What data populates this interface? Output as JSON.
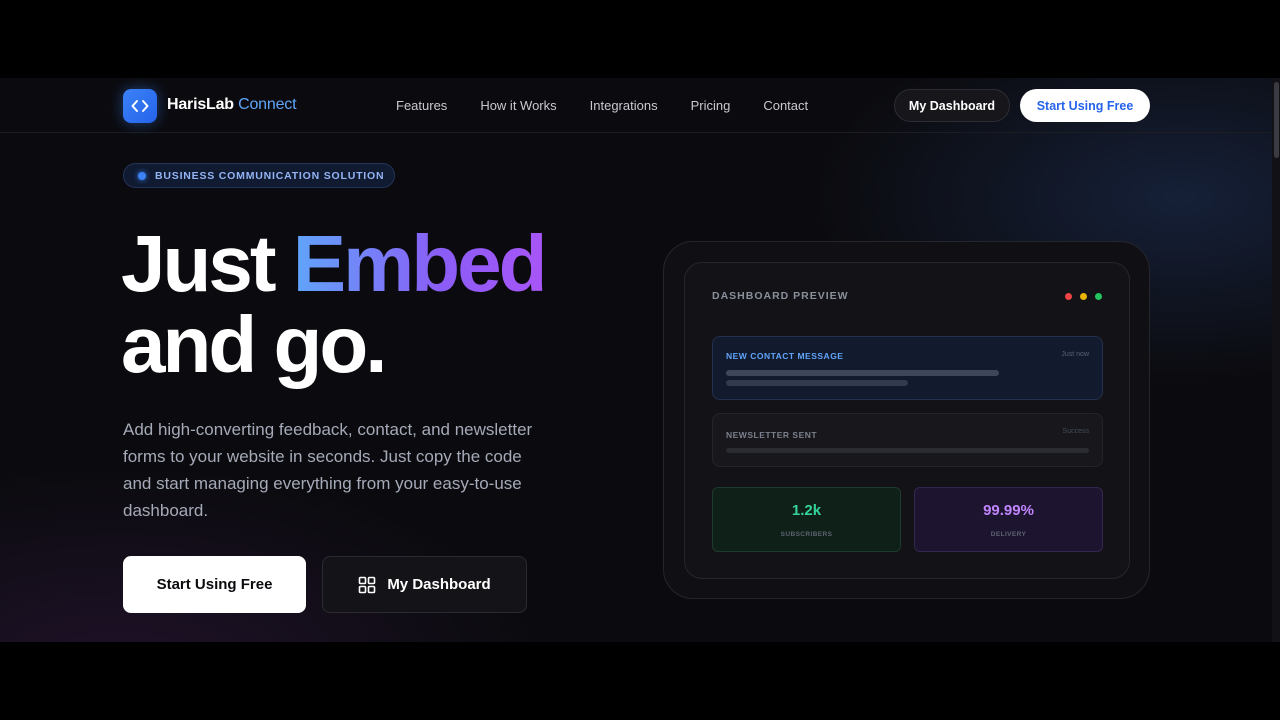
{
  "brand": {
    "name_part1": "HarisLab",
    "name_part2": "Connect",
    "accent_color": "#3b82f6",
    "logo_icon": "code-brackets-icon"
  },
  "nav": {
    "links": [
      "Features",
      "How it Works",
      "Integrations",
      "Pricing",
      "Contact"
    ],
    "dashboard_button": "My Dashboard",
    "start_button": "Start Using Free"
  },
  "hero": {
    "badge": "BUSINESS COMMUNICATION SOLUTION",
    "headline_part1": "Just",
    "headline_highlight": "Embed",
    "headline_line2": "and go.",
    "description": "Add high-converting feedback, contact, and newsletter forms to your website in seconds. Just copy the code and start managing everything from your easy-to-use dashboard.",
    "primary_button": "Start Using Free",
    "secondary_button": "My Dashboard",
    "secondary_icon": "grid-icon"
  },
  "preview": {
    "title": "DASHBOARD PREVIEW",
    "window_dots": [
      "#ef4444",
      "#eab308",
      "#22c55e"
    ],
    "message_card": {
      "title": "NEW CONTACT MESSAGE",
      "time": "Just now"
    },
    "newsletter_card": {
      "title": "NEWSLETTER SENT",
      "status": "Success"
    },
    "stats": [
      {
        "value": "1.2k",
        "label": "SUBSCRIBERS"
      },
      {
        "value": "99.99%",
        "label": "DELIVERY"
      }
    ]
  }
}
